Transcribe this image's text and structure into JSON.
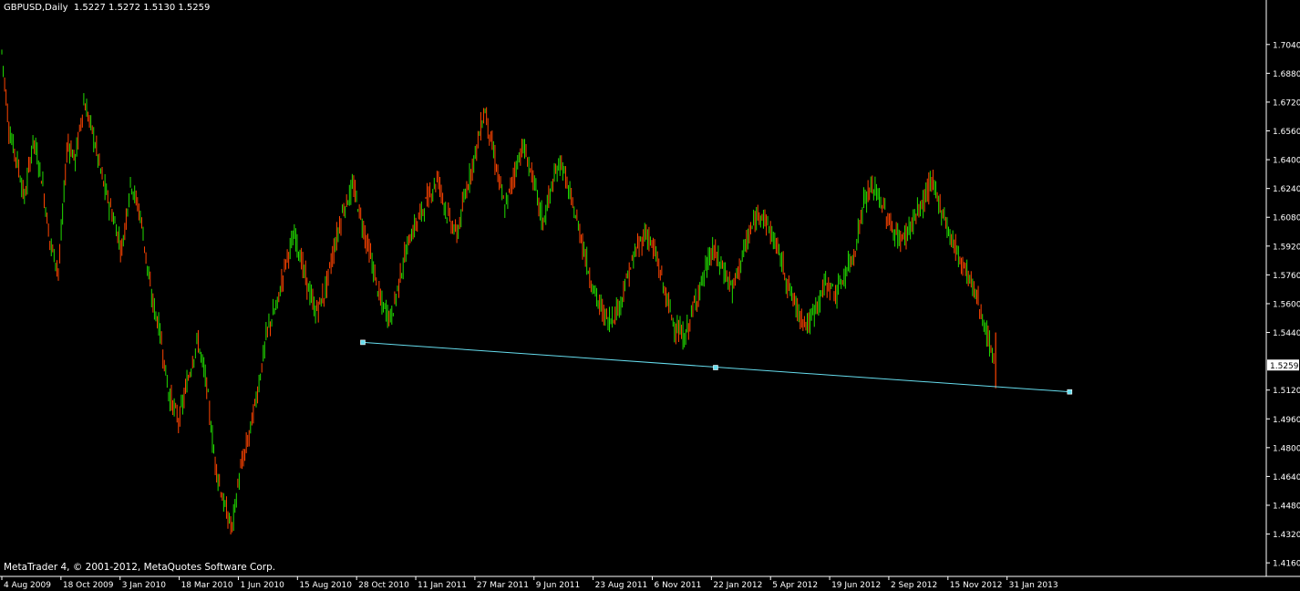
{
  "header": {
    "symbol": "GBPUSD,Daily",
    "ohlc": "1.5227 1.5272 1.5130 1.5259"
  },
  "footer": {
    "copyright": "MetaTrader 4, © 2001-2012, MetaQuotes Software Corp."
  },
  "colors": {
    "background": "#000000",
    "axis": "#ffffff",
    "bull": "#22dd00",
    "bear": "#ff4400",
    "trendline": "#66ddee",
    "price_tag_bg": "#ffffff",
    "price_tag_text": "#000000"
  },
  "chart_data": {
    "type": "bar",
    "instrument": "GBPUSD",
    "timeframe": "Daily",
    "y_ticks": [
      "1.7040",
      "1.6880",
      "1.6720",
      "1.6560",
      "1.6400",
      "1.6240",
      "1.6080",
      "1.5920",
      "1.5760",
      "1.5600",
      "1.5440",
      "1.5120",
      "1.4960",
      "1.4800",
      "1.4640",
      "1.4480",
      "1.4320",
      "1.4160"
    ],
    "ylim": [
      1.411,
      1.712
    ],
    "x_ticks": [
      "4 Aug 2009",
      "18 Oct 2009",
      "3 Jan 2010",
      "18 Mar 2010",
      "1 Jun 2010",
      "15 Aug 2010",
      "28 Oct 2010",
      "11 Jan 2011",
      "27 Mar 2011",
      "9 Jun 2011",
      "23 Aug 2011",
      "6 Nov 2011",
      "22 Jan 2012",
      "5 Apr 2012",
      "19 Jun 2012",
      "2 Sep 2012",
      "15 Nov 2012",
      "31 Jan 2013"
    ],
    "current_price": "1.5259",
    "price_path": [
      [
        0,
        1.7
      ],
      [
        0.006,
        1.655
      ],
      [
        0.012,
        1.64
      ],
      [
        0.018,
        1.618
      ],
      [
        0.025,
        1.652
      ],
      [
        0.032,
        1.628
      ],
      [
        0.038,
        1.595
      ],
      [
        0.045,
        1.578
      ],
      [
        0.052,
        1.65
      ],
      [
        0.058,
        1.64
      ],
      [
        0.065,
        1.672
      ],
      [
        0.072,
        1.655
      ],
      [
        0.08,
        1.628
      ],
      [
        0.088,
        1.608
      ],
      [
        0.095,
        1.59
      ],
      [
        0.102,
        1.628
      ],
      [
        0.11,
        1.608
      ],
      [
        0.118,
        1.565
      ],
      [
        0.125,
        1.545
      ],
      [
        0.132,
        1.51
      ],
      [
        0.14,
        1.495
      ],
      [
        0.148,
        1.52
      ],
      [
        0.155,
        1.54
      ],
      [
        0.162,
        1.515
      ],
      [
        0.168,
        1.475
      ],
      [
        0.175,
        1.45
      ],
      [
        0.182,
        1.435
      ],
      [
        0.188,
        1.465
      ],
      [
        0.195,
        1.485
      ],
      [
        0.202,
        1.51
      ],
      [
        0.21,
        1.545
      ],
      [
        0.218,
        1.56
      ],
      [
        0.225,
        1.585
      ],
      [
        0.232,
        1.598
      ],
      [
        0.24,
        1.575
      ],
      [
        0.248,
        1.555
      ],
      [
        0.255,
        1.565
      ],
      [
        0.262,
        1.588
      ],
      [
        0.27,
        1.612
      ],
      [
        0.278,
        1.625
      ],
      [
        0.285,
        1.605
      ],
      [
        0.292,
        1.585
      ],
      [
        0.3,
        1.56
      ],
      [
        0.308,
        1.552
      ],
      [
        0.315,
        1.575
      ],
      [
        0.322,
        1.595
      ],
      [
        0.33,
        1.608
      ],
      [
        0.338,
        1.62
      ],
      [
        0.345,
        1.63
      ],
      [
        0.352,
        1.61
      ],
      [
        0.36,
        1.598
      ],
      [
        0.368,
        1.625
      ],
      [
        0.375,
        1.645
      ],
      [
        0.382,
        1.668
      ],
      [
        0.39,
        1.64
      ],
      [
        0.398,
        1.612
      ],
      [
        0.405,
        1.632
      ],
      [
        0.412,
        1.648
      ],
      [
        0.42,
        1.63
      ],
      [
        0.428,
        1.605
      ],
      [
        0.435,
        1.625
      ],
      [
        0.442,
        1.64
      ],
      [
        0.45,
        1.618
      ],
      [
        0.458,
        1.598
      ],
      [
        0.465,
        1.575
      ],
      [
        0.472,
        1.56
      ],
      [
        0.48,
        1.55
      ],
      [
        0.488,
        1.558
      ],
      [
        0.495,
        1.575
      ],
      [
        0.502,
        1.59
      ],
      [
        0.51,
        1.6
      ],
      [
        0.518,
        1.585
      ],
      [
        0.525,
        1.565
      ],
      [
        0.532,
        1.548
      ],
      [
        0.54,
        1.54
      ],
      [
        0.548,
        1.56
      ],
      [
        0.555,
        1.575
      ],
      [
        0.562,
        1.59
      ],
      [
        0.57,
        1.58
      ],
      [
        0.578,
        1.568
      ],
      [
        0.585,
        1.585
      ],
      [
        0.592,
        1.6
      ],
      [
        0.6,
        1.612
      ],
      [
        0.608,
        1.6
      ],
      [
        0.615,
        1.588
      ],
      [
        0.622,
        1.57
      ],
      [
        0.63,
        1.555
      ],
      [
        0.638,
        1.548
      ],
      [
        0.645,
        1.56
      ],
      [
        0.652,
        1.572
      ],
      [
        0.66,
        1.565
      ],
      [
        0.668,
        1.578
      ],
      [
        0.675,
        1.59
      ],
      [
        0.682,
        1.618
      ],
      [
        0.69,
        1.625
      ],
      [
        0.698,
        1.612
      ],
      [
        0.705,
        1.6
      ],
      [
        0.712,
        1.595
      ],
      [
        0.72,
        1.605
      ],
      [
        0.728,
        1.615
      ],
      [
        0.735,
        1.628
      ],
      [
        0.742,
        1.615
      ],
      [
        0.75,
        1.598
      ],
      [
        0.758,
        1.585
      ],
      [
        0.765,
        1.575
      ],
      [
        0.772,
        1.562
      ],
      [
        0.78,
        1.54
      ],
      [
        0.786,
        1.525
      ]
    ],
    "trendline": {
      "start": {
        "xr": 0.2855,
        "y": 1.5385
      },
      "mid": {
        "xr": 0.5645,
        "y": 1.5245
      },
      "end": {
        "xr": 0.8445,
        "y": 1.511
      }
    }
  }
}
